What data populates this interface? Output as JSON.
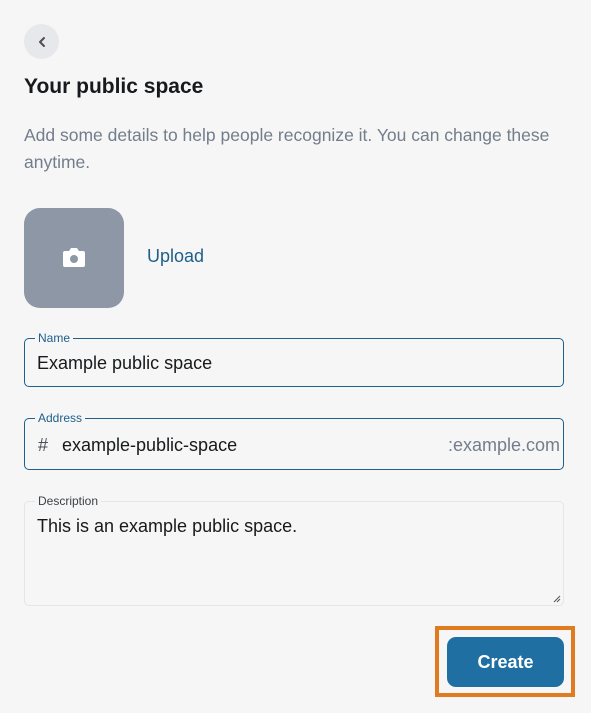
{
  "header": {
    "back_icon": "chevron-left-icon",
    "title": "Your public space",
    "subtitle": "Add some details to help people recognize it. You can change these anytime."
  },
  "avatar": {
    "icon": "camera-icon",
    "upload_label": "Upload"
  },
  "fields": {
    "name": {
      "label": "Name",
      "value": "Example public space"
    },
    "address": {
      "label": "Address",
      "prefix": "#",
      "value": "example-public-space",
      "suffix": ":example.com"
    },
    "description": {
      "label": "Description",
      "value": "This is an example public space."
    }
  },
  "actions": {
    "create_label": "Create"
  },
  "colors": {
    "accent": "#1f5f8b",
    "button": "#1f6fa3",
    "highlight": "#e07b20",
    "avatar_bg": "#8d97a5"
  }
}
